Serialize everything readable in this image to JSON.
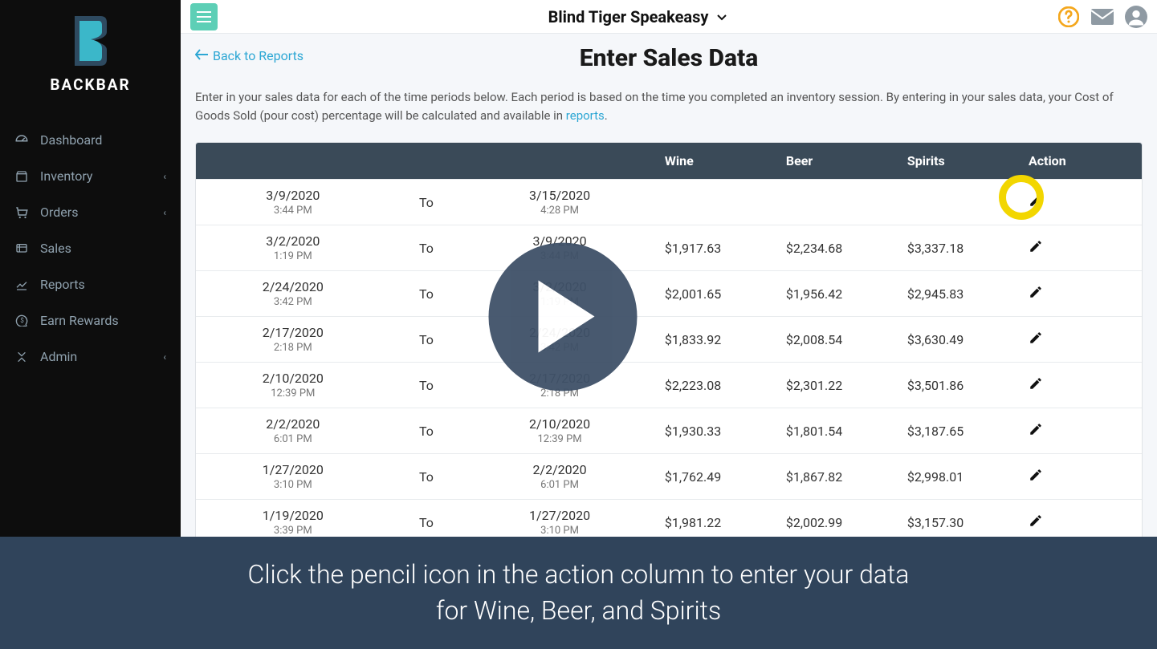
{
  "brand": {
    "name": "BACKBAR"
  },
  "topbar": {
    "venue": "Blind Tiger Speakeasy"
  },
  "nav": [
    {
      "label": "Dashboard",
      "expandable": false
    },
    {
      "label": "Inventory",
      "expandable": true
    },
    {
      "label": "Orders",
      "expandable": true
    },
    {
      "label": "Sales",
      "expandable": false
    },
    {
      "label": "Reports",
      "expandable": false
    },
    {
      "label": "Earn Rewards",
      "expandable": false
    },
    {
      "label": "Admin",
      "expandable": true
    }
  ],
  "page": {
    "back_label": "Back to Reports",
    "title": "Enter Sales Data",
    "intro_prefix": "Enter in your sales data for each of the time periods below. Each period is based on the time you completed an inventory session. By entering in your sales data, your Cost of Goods Sold (pour cost) percentage will be calculated and available in ",
    "intro_link": "reports",
    "intro_suffix": "."
  },
  "table": {
    "headers": {
      "wine": "Wine",
      "beer": "Beer",
      "spirits": "Spirits",
      "action": "Action"
    },
    "to_label": "To",
    "rows": [
      {
        "start_date": "3/9/2020",
        "start_time": "3:44 PM",
        "end_date": "3/15/2020",
        "end_time": "4:28 PM",
        "wine": "",
        "beer": "",
        "spirits": ""
      },
      {
        "start_date": "3/2/2020",
        "start_time": "1:19 PM",
        "end_date": "3/9/2020",
        "end_time": "3:44 PM",
        "wine": "$1,917.63",
        "beer": "$2,234.68",
        "spirits": "$3,337.18"
      },
      {
        "start_date": "2/24/2020",
        "start_time": "3:42 PM",
        "end_date": "3/2/2020",
        "end_time": "1:19 PM",
        "wine": "$2,001.65",
        "beer": "$1,956.42",
        "spirits": "$2,945.83"
      },
      {
        "start_date": "2/17/2020",
        "start_time": "2:18 PM",
        "end_date": "2/24/2020",
        "end_time": "3:42 PM",
        "wine": "$1,833.92",
        "beer": "$2,008.54",
        "spirits": "$3,630.49"
      },
      {
        "start_date": "2/10/2020",
        "start_time": "12:39 PM",
        "end_date": "2/17/2020",
        "end_time": "2:18 PM",
        "wine": "$2,223.08",
        "beer": "$2,301.22",
        "spirits": "$3,501.86"
      },
      {
        "start_date": "2/2/2020",
        "start_time": "6:01 PM",
        "end_date": "2/10/2020",
        "end_time": "12:39 PM",
        "wine": "$1,930.33",
        "beer": "$1,801.54",
        "spirits": "$3,187.65"
      },
      {
        "start_date": "1/27/2020",
        "start_time": "3:10 PM",
        "end_date": "2/2/2020",
        "end_time": "6:01 PM",
        "wine": "$1,762.49",
        "beer": "$1,867.82",
        "spirits": "$2,998.01"
      },
      {
        "start_date": "1/19/2020",
        "start_time": "3:39 PM",
        "end_date": "1/27/2020",
        "end_time": "3:10 PM",
        "wine": "$1,981.22",
        "beer": "$2,002.99",
        "spirits": "$3,157.30"
      }
    ]
  },
  "caption": {
    "line1": "Click the pencil icon in the action column to enter your data",
    "line2": "for Wine, Beer, and Spirits"
  }
}
